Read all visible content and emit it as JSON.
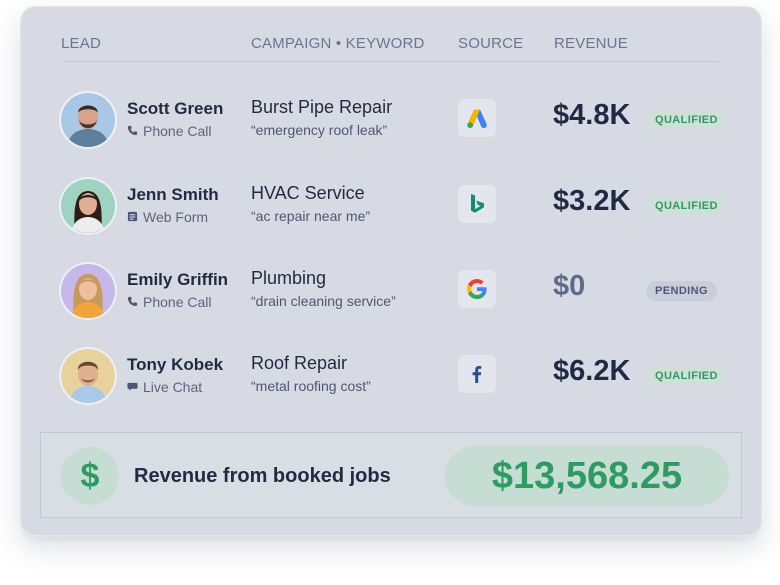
{
  "headers": {
    "lead": "LEAD",
    "campaign": "CAMPAIGN • KEYWORD",
    "source": "SOURCE",
    "revenue": "REVENUE"
  },
  "rows": [
    {
      "name": "Scott Green",
      "channel": "Phone Call",
      "channel_icon": "phone-icon",
      "campaign": "Burst Pipe Repair",
      "keyword": "“emergency roof leak”",
      "source_icon": "google-ads-icon",
      "revenue": "$4.8K",
      "status": "QUALIFIED"
    },
    {
      "name": "Jenn Smith",
      "channel": "Web Form",
      "channel_icon": "web-form-icon",
      "campaign": "HVAC Service",
      "keyword": "“ac repair near me”",
      "source_icon": "bing-icon",
      "revenue": "$3.2K",
      "status": "QUALIFIED"
    },
    {
      "name": "Emily Griffin",
      "channel": "Phone Call",
      "channel_icon": "phone-icon",
      "campaign": "Plumbing",
      "keyword": "“drain cleaning service”",
      "source_icon": "google-icon",
      "revenue": "$0",
      "status": "PENDING"
    },
    {
      "name": "Tony Kobek",
      "channel": "Live Chat",
      "channel_icon": "chat-icon",
      "campaign": "Roof Repair",
      "keyword": "“metal roofing cost”",
      "source_icon": "facebook-icon",
      "revenue": "$6.2K",
      "status": "QUALIFIED"
    }
  ],
  "footer": {
    "dollar_symbol": "$",
    "label": "Revenue from booked jobs",
    "total": "$13,568.25"
  },
  "colors": {
    "card_bg": "#d7dae2",
    "accent_green": "#2f9a62",
    "green_tint": "#c6ddd3",
    "text_dark": "#1f2a44",
    "header_text": "#6a7594"
  }
}
